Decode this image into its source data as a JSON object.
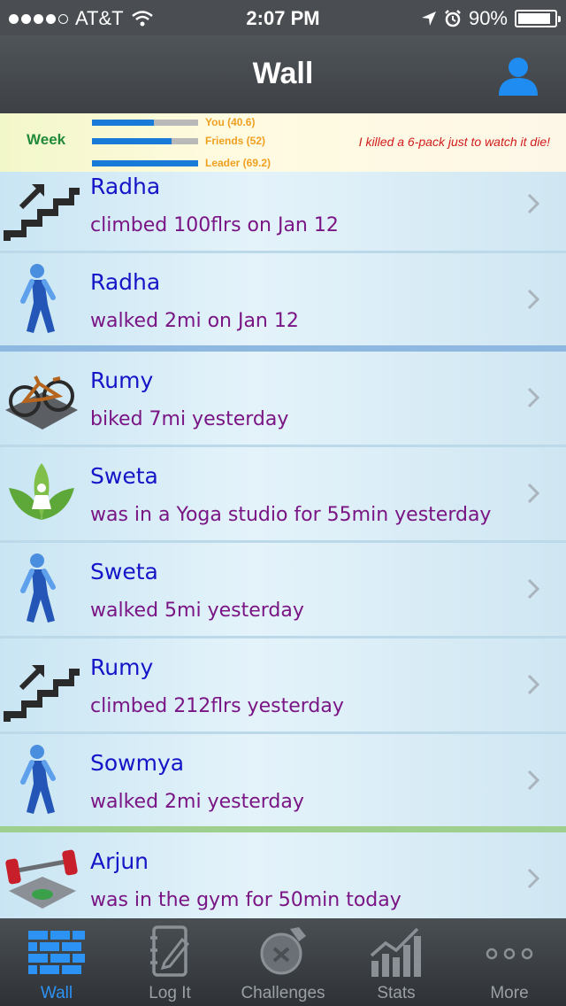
{
  "status": {
    "carrier": "AT&T",
    "time": "2:07 PM",
    "battery_text": "90%",
    "battery_level": 0.9,
    "signal_bars": 4,
    "signal_max": 5
  },
  "nav": {
    "title": "Wall",
    "profile_icon": "person-icon"
  },
  "summary": {
    "period": "Week",
    "bars": [
      {
        "label": "You (40.6)",
        "fraction": 0.587
      },
      {
        "label": "Friends (52)",
        "fraction": 0.75
      },
      {
        "label": "Leader (69.2)",
        "fraction": 1.0
      }
    ],
    "quote": "I killed a 6-pack just to watch it die!"
  },
  "feed": [
    {
      "name": "Radha",
      "activity": "climbed 100flrs on Jan 12",
      "icon": "stairs-icon"
    },
    {
      "name": "Radha",
      "activity": "walked 2mi on Jan 12",
      "icon": "walking-person-icon"
    },
    {
      "name": "Rumy",
      "activity": "biked 7mi yesterday",
      "icon": "bicycle-icon"
    },
    {
      "name": "Sweta",
      "activity": "was in a Yoga studio for 55min yesterday",
      "icon": "yoga-lotus-icon"
    },
    {
      "name": "Sweta",
      "activity": "walked 5mi yesterday",
      "icon": "walking-person-icon"
    },
    {
      "name": "Rumy",
      "activity": "climbed 212flrs yesterday",
      "icon": "stairs-icon"
    },
    {
      "name": "Sowmya",
      "activity": "walked 2mi yesterday",
      "icon": "walking-person-icon"
    },
    {
      "name": "Arjun",
      "activity": "was in the gym for 50min today",
      "icon": "barbell-icon"
    }
  ],
  "tabs": [
    {
      "label": "Wall",
      "icon": "brick-wall-icon",
      "active": true
    },
    {
      "label": "Log It",
      "icon": "notebook-pencil-icon",
      "active": false
    },
    {
      "label": "Challenges",
      "icon": "challenge-badge-icon",
      "active": false
    },
    {
      "label": "Stats",
      "icon": "bar-chart-icon",
      "active": false
    },
    {
      "label": "More",
      "icon": "more-dots-icon",
      "active": false
    }
  ],
  "colors": {
    "accent": "#2c93f5",
    "name": "#1515c8",
    "activity": "#7a1585",
    "week": "#238a3a",
    "quote": "#d11b1b",
    "bar_label": "#f0a020"
  }
}
